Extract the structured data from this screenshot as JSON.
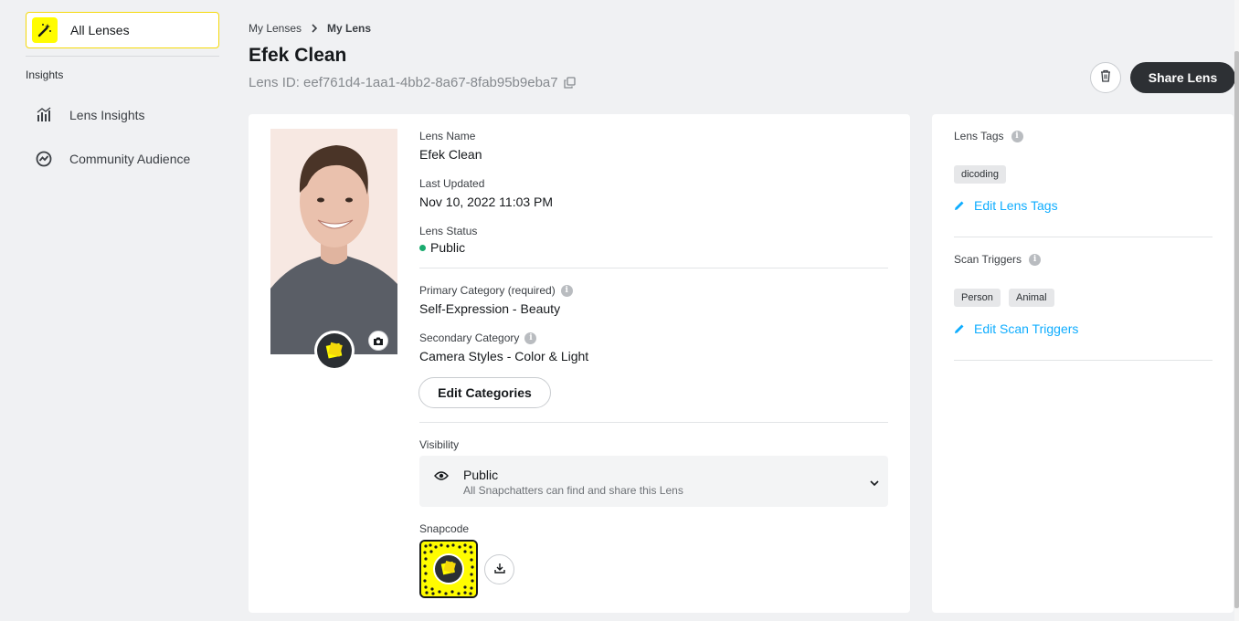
{
  "sidebar": {
    "all_lenses": "All Lenses",
    "section": "Insights",
    "items": [
      {
        "label": "Lens Insights",
        "icon": "bar-chart-icon"
      },
      {
        "label": "Community Audience",
        "icon": "trend-circle-icon"
      }
    ]
  },
  "header": {
    "breadcrumb": [
      "My Lenses",
      "My Lens"
    ],
    "title": "Efek Clean",
    "lens_id": "Lens ID: eef761d4-1aa1-4bb2-8a67-8fab95b9eba7",
    "share_label": "Share Lens"
  },
  "details": {
    "lens_name_label": "Lens Name",
    "lens_name": "Efek Clean",
    "last_updated_label": "Last Updated",
    "last_updated": "Nov 10, 2022 11:03 PM",
    "status_label": "Lens Status",
    "status": "Public",
    "primary_label": "Primary Category (required)",
    "primary": "Self-Expression - Beauty",
    "secondary_label": "Secondary Category",
    "secondary": "Camera Styles - Color & Light",
    "edit_categories": "Edit Categories",
    "visibility_label": "Visibility",
    "visibility_value": "Public",
    "visibility_desc": "All Snapchatters can find and share this Lens",
    "snapcode_label": "Snapcode"
  },
  "side": {
    "tags_label": "Lens Tags",
    "tags": [
      "dicoding"
    ],
    "edit_tags": "Edit Lens Tags",
    "triggers_label": "Scan Triggers",
    "triggers": [
      "Person",
      "Animal"
    ],
    "edit_triggers": "Edit Scan Triggers"
  },
  "colors": {
    "accent_yellow": "#fffc00",
    "link_blue": "#0fadff",
    "status_green": "#1aab6f",
    "dark_button": "#2d3034"
  }
}
